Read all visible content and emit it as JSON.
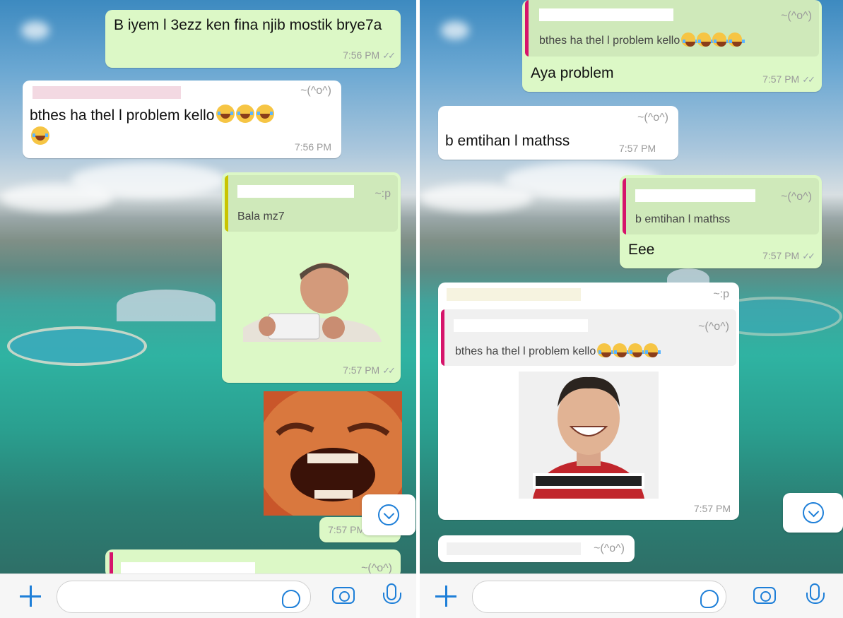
{
  "colors": {
    "outgoing": "#dcf8c6",
    "incoming": "#ffffff",
    "accent": "#1e7fd8",
    "quote_bar_green": "#c9c400",
    "quote_bar_magenta": "#d6146b"
  },
  "left": {
    "m1": {
      "text": "B iyem l 3ezz ken fina njib mostik brye7a",
      "time": "7:56 PM"
    },
    "m2": {
      "nick": "~(^o^)",
      "text": "bthes ha thel l problem kello",
      "time": "7:56 PM"
    },
    "m3": {
      "nick": "~:p",
      "quote": "Bala mz7",
      "time": "7:57 PM",
      "image": "man-laughing-phone-meme"
    },
    "m4": {
      "image": "laughing-face-closeup"
    },
    "m5": {
      "time": "7:57 PM"
    },
    "m6": {
      "nick": "~(^o^)"
    }
  },
  "right": {
    "r1": {
      "nick": "~(^o^)",
      "quote": "bthes ha thel l problem kello",
      "text": "Aya problem",
      "time": "7:57 PM"
    },
    "r2": {
      "nick": "~(^o^)",
      "text": "b emtihan l mathss",
      "time": "7:57 PM"
    },
    "r3": {
      "nick": "~(^o^)",
      "quote": "b emtihan l mathss",
      "text": "Eee",
      "time": "7:57 PM"
    },
    "r4": {
      "nick": "~:p",
      "quote_nick": "~(^o^)",
      "quote": "bthes ha thel l problem kello",
      "time": "7:57 PM",
      "image": "smiling-man-red-jacket-meme"
    },
    "r5": {
      "nick": "~(^o^)"
    }
  },
  "icons": {
    "plus": "plus-icon",
    "sticker": "sticker-icon",
    "camera": "camera-icon",
    "mic": "microphone-icon",
    "scroll": "scroll-down-icon"
  }
}
